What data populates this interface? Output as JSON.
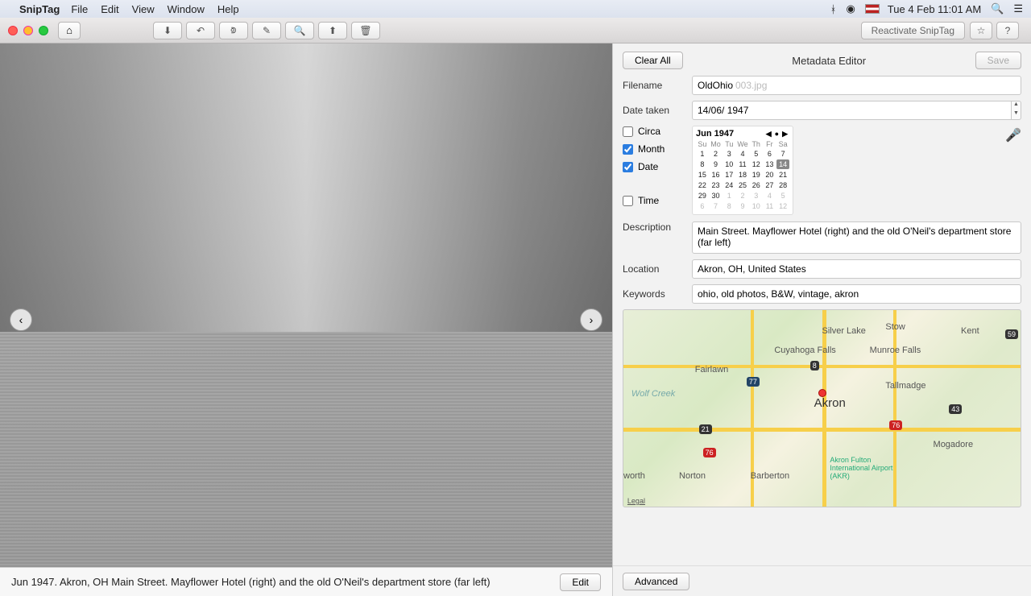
{
  "menubar": {
    "app_name": "SnipTag",
    "items": [
      "File",
      "Edit",
      "View",
      "Window",
      "Help"
    ],
    "clock": "Tue 4 Feb  11:01 AM"
  },
  "toolbar": {
    "reactivate": "Reactivate SnipTag"
  },
  "image_pane": {
    "caption": "Jun 1947. Akron, OH Main Street. Mayflower Hotel (right) and the old O'Neil's department store (far left)",
    "edit": "Edit"
  },
  "side": {
    "clear": "Clear All",
    "title": "Metadata Editor",
    "save": "Save",
    "filename_label": "Filename",
    "filename_value": "OldOhio",
    "filename_suffix": "003.jpg",
    "date_taken_label": "Date taken",
    "date_taken_value": "14/06/ 1947",
    "circa": "Circa",
    "month": "Month",
    "date": "Date",
    "time": "Time",
    "cal_month": "Jun 1947",
    "cal_dow": [
      "Su",
      "Mo",
      "Tu",
      "We",
      "Th",
      "Fr",
      "Sa"
    ],
    "cal_days": [
      {
        "n": "1"
      },
      {
        "n": "2"
      },
      {
        "n": "3"
      },
      {
        "n": "4"
      },
      {
        "n": "5"
      },
      {
        "n": "6"
      },
      {
        "n": "7"
      },
      {
        "n": "8"
      },
      {
        "n": "9"
      },
      {
        "n": "10"
      },
      {
        "n": "11"
      },
      {
        "n": "12"
      },
      {
        "n": "13"
      },
      {
        "n": "14",
        "sel": true
      },
      {
        "n": "15"
      },
      {
        "n": "16"
      },
      {
        "n": "17"
      },
      {
        "n": "18"
      },
      {
        "n": "19"
      },
      {
        "n": "20"
      },
      {
        "n": "21"
      },
      {
        "n": "22"
      },
      {
        "n": "23"
      },
      {
        "n": "24"
      },
      {
        "n": "25"
      },
      {
        "n": "26"
      },
      {
        "n": "27"
      },
      {
        "n": "28"
      },
      {
        "n": "29"
      },
      {
        "n": "30"
      },
      {
        "n": "1",
        "o": true
      },
      {
        "n": "2",
        "o": true
      },
      {
        "n": "3",
        "o": true
      },
      {
        "n": "4",
        "o": true
      },
      {
        "n": "5",
        "o": true
      },
      {
        "n": "6",
        "o": true
      },
      {
        "n": "7",
        "o": true
      },
      {
        "n": "8",
        "o": true
      },
      {
        "n": "9",
        "o": true
      },
      {
        "n": "10",
        "o": true
      },
      {
        "n": "11",
        "o": true
      },
      {
        "n": "12",
        "o": true
      }
    ],
    "description_label": "Description",
    "description_value": "Main Street. Mayflower Hotel (right) and the old O'Neil's department store (far left)",
    "location_label": "Location",
    "location_value": "Akron, OH, United States",
    "keywords_label": "Keywords",
    "keywords_value": "ohio, old photos, B&W, vintage, akron",
    "map_places": {
      "akron": "Akron",
      "silver": "Silver Lake",
      "stow": "Stow",
      "kent": "Kent",
      "cuyahoga": "Cuyahoga Falls",
      "munroe": "Munroe Falls",
      "fairlawn": "Fairlawn",
      "tallmadge": "Tallmadge",
      "mogadore": "Mogadore",
      "norton": "Norton",
      "barberton": "Barberton",
      "worth": "worth",
      "wolf": "Wolf Creek",
      "legal": "Legal",
      "airport": "Akron Fulton International Airport (AKR)"
    },
    "map_shields": {
      "s77": "77",
      "s76": "76",
      "s76b": "76",
      "s21": "21",
      "s43": "43",
      "s59": "59",
      "s8": "8"
    },
    "advanced": "Advanced"
  }
}
